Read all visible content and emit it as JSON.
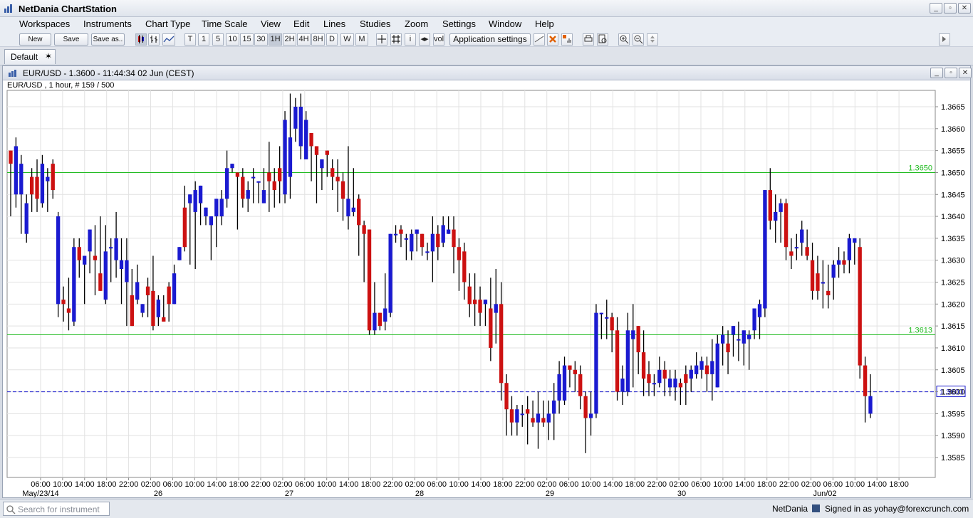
{
  "app": {
    "title": "NetDania ChartStation"
  },
  "menu": [
    "Workspaces",
    "Instruments",
    "Chart Type",
    "Time Scale",
    "View",
    "Edit",
    "Lines",
    "Studies",
    "Zoom",
    "Settings",
    "Window",
    "Help"
  ],
  "toolbar": {
    "new_label": "New",
    "save_label": "Save",
    "save_as_label": "Save as..",
    "timescales": [
      "T",
      "1",
      "5",
      "10",
      "15",
      "30",
      "1H",
      "2H",
      "4H",
      "8H",
      "D",
      "W",
      "M"
    ],
    "active_timescale": "1H",
    "app_settings_label": "Application settings"
  },
  "workspace_tab": {
    "label": "Default"
  },
  "chart_window": {
    "title": "EUR/USD - 1.3600 - 11:44:34  02 Jun (CEST)",
    "info": "EUR/USD , 1 hour, # 159 / 500"
  },
  "status": {
    "search_placeholder": "Search for instrument",
    "provider": "NetDania",
    "signed_in": "Signed in as yohay@forexcrunch.com"
  },
  "chart_data": {
    "type": "candlestick",
    "symbol": "EUR/USD",
    "interval": "1 hour",
    "ylim": [
      1.3585,
      1.3668
    ],
    "yticks": [
      "1.3665",
      "1.3660",
      "1.3655",
      "1.3650",
      "1.3645",
      "1.3640",
      "1.3635",
      "1.3630",
      "1.3625",
      "1.3620",
      "1.3615",
      "1.3610",
      "1.3605",
      "1.3600",
      "1.3595",
      "1.3590",
      "1.3585"
    ],
    "x_time_labels": [
      "06:00",
      "10:00",
      "14:00",
      "18:00",
      "22:00",
      "02:00",
      "06:00",
      "10:00",
      "14:00",
      "18:00",
      "22:00",
      "02:00",
      "06:00",
      "10:00",
      "14:00",
      "18:00",
      "22:00",
      "02:00",
      "06:00",
      "10:00",
      "14:00",
      "18:00",
      "22:00",
      "02:00",
      "06:00",
      "10:00",
      "14:00",
      "18:00",
      "22:00",
      "02:00",
      "06:00",
      "10:00",
      "14:00",
      "18:00",
      "22:00",
      "02:00",
      "06:00",
      "10:00",
      "14:00",
      "18:00"
    ],
    "x_date_labels": [
      "May/23/14",
      "26",
      "27",
      "28",
      "29",
      "30",
      "Jun/02"
    ],
    "horizontal_lines": [
      {
        "label": "1.3650",
        "value": 1.365,
        "color": "#22bb22"
      },
      {
        "label": "1.3613",
        "value": 1.3613,
        "color": "#22bb22"
      }
    ],
    "current_price": {
      "label": "1.3600",
      "value": 1.36,
      "color": "#1a1acc"
    },
    "colors": {
      "up": "#1a1ad0",
      "down": "#cc1111",
      "wick": "#000000",
      "grid": "#e2e2e2"
    },
    "candles": [
      [
        1.3655,
        1.3652,
        1.3653,
        1.364
      ],
      [
        1.3645,
        1.3656,
        1.3658,
        1.3642
      ],
      [
        1.3645,
        1.3652,
        1.3654,
        1.3636
      ],
      [
        1.3636,
        1.3643,
        1.3645,
        1.3634
      ],
      [
        1.3649,
        1.3645,
        1.3651,
        1.3641
      ],
      [
        1.3649,
        1.3644,
        1.3653,
        1.3641
      ],
      [
        1.3643,
        1.3652,
        1.3654,
        1.3642
      ],
      [
        1.3648,
        1.3649,
        1.3651,
        1.3641
      ],
      [
        1.3652,
        1.3646,
        1.3653,
        1.3644
      ],
      [
        1.362,
        1.364,
        1.3641,
        1.3617
      ],
      [
        1.3621,
        1.362,
        1.3624,
        1.3616
      ],
      [
        1.3619,
        1.3618,
        1.3626,
        1.3614
      ],
      [
        1.3616,
        1.3633,
        1.3635,
        1.3615
      ],
      [
        1.3633,
        1.363,
        1.3635,
        1.3626
      ],
      [
        1.3629,
        1.3631,
        1.3631,
        1.362
      ],
      [
        1.3632,
        1.3637,
        1.3637,
        1.3627
      ],
      [
        1.3631,
        1.363,
        1.3638,
        1.3622
      ],
      [
        1.3627,
        1.3623,
        1.364,
        1.3624
      ],
      [
        1.3621,
        1.3632,
        1.3638,
        1.362
      ],
      [
        1.3633,
        1.3633,
        1.3635,
        1.3625
      ],
      [
        1.363,
        1.3635,
        1.3641,
        1.3626
      ],
      [
        1.3628,
        1.363,
        1.3635,
        1.362
      ],
      [
        1.3625,
        1.363,
        1.3635,
        1.3615
      ],
      [
        1.3622,
        1.3615,
        1.3628,
        1.3617
      ],
      [
        1.3621,
        1.3625,
        1.3629,
        1.362
      ],
      [
        1.3618,
        1.362,
        1.362,
        1.3617
      ],
      [
        1.3624,
        1.3622,
        1.3626,
        1.3617
      ],
      [
        1.3623,
        1.3615,
        1.3631,
        1.3614
      ],
      [
        1.3617,
        1.3621,
        1.3622,
        1.3615
      ],
      [
        1.3617,
        1.3616,
        1.3622,
        1.3616
      ],
      [
        1.3624,
        1.362,
        1.3625,
        1.3616
      ],
      [
        1.362,
        1.3627,
        1.3629,
        1.362
      ],
      [
        1.363,
        1.3633,
        1.3632,
        1.3632
      ],
      [
        1.3642,
        1.3633,
        1.3647,
        1.3632
      ],
      [
        1.3643,
        1.3645,
        1.364,
        1.3629
      ],
      [
        1.3641,
        1.3646,
        1.3648,
        1.3628
      ],
      [
        1.3643,
        1.3647,
        1.3644,
        1.3638
      ],
      [
        1.364,
        1.3642,
        1.3639,
        1.3638
      ],
      [
        1.3638,
        1.364,
        1.364,
        1.363
      ],
      [
        1.364,
        1.3644,
        1.3641,
        1.3633
      ],
      [
        1.364,
        1.3644,
        1.3646,
        1.3638
      ],
      [
        1.3644,
        1.3651,
        1.3655,
        1.3642
      ],
      [
        1.3651,
        1.3652,
        1.3651,
        1.365
      ],
      [
        1.365,
        1.3649,
        1.3644,
        1.3637
      ],
      [
        1.3649,
        1.3644,
        1.3651,
        1.3642
      ],
      [
        1.3644,
        1.3646,
        1.3648,
        1.3641
      ],
      [
        1.3649,
        1.3649,
        1.3651,
        1.3643
      ],
      [
        1.3648,
        1.3648,
        1.3648,
        1.3643
      ],
      [
        1.3643,
        1.3646,
        1.3651,
        1.3644
      ],
      [
        1.365,
        1.3648,
        1.3657,
        1.3641
      ],
      [
        1.3648,
        1.3646,
        1.3651,
        1.3642
      ],
      [
        1.3651,
        1.3648,
        1.3656,
        1.3643
      ],
      [
        1.3645,
        1.3662,
        1.3664,
        1.3643
      ],
      [
        1.3649,
        1.3658,
        1.3668,
        1.3644
      ],
      [
        1.366,
        1.3665,
        1.3667,
        1.3657
      ],
      [
        1.3656,
        1.3665,
        1.3668,
        1.3653
      ],
      [
        1.3653,
        1.3662,
        1.3664,
        1.3653
      ],
      [
        1.3659,
        1.3656,
        1.3658,
        1.3648
      ],
      [
        1.3656,
        1.3654,
        1.3656,
        1.3643
      ],
      [
        1.3651,
        1.3653,
        1.3653,
        1.3646
      ],
      [
        1.3655,
        1.3654,
        1.3655,
        1.3649
      ],
      [
        1.3651,
        1.3649,
        1.3653,
        1.3646
      ],
      [
        1.3649,
        1.3648,
        1.3653,
        1.3641
      ],
      [
        1.3648,
        1.3644,
        1.365,
        1.3639
      ],
      [
        1.364,
        1.3644,
        1.3656,
        1.3637
      ],
      [
        1.3641,
        1.3642,
        1.3651,
        1.364
      ],
      [
        1.3644,
        1.3638,
        1.3645,
        1.3631
      ],
      [
        1.3638,
        1.3636,
        1.3639,
        1.3625
      ],
      [
        1.3637,
        1.3614,
        1.3636,
        1.3613
      ],
      [
        1.3614,
        1.3618,
        1.3625,
        1.3613
      ],
      [
        1.3618,
        1.3615,
        1.3617,
        1.3614
      ],
      [
        1.3616,
        1.3619,
        1.3627,
        1.3614
      ],
      [
        1.3618,
        1.3636,
        1.3636,
        1.3617
      ],
      [
        1.3636,
        1.3636,
        1.3638,
        1.3634
      ],
      [
        1.3637,
        1.3636,
        1.3638,
        1.3633
      ],
      [
        1.3635,
        1.3635,
        1.3636,
        1.363
      ],
      [
        1.3632,
        1.3636,
        1.3637,
        1.363
      ],
      [
        1.3636,
        1.3637,
        1.3637,
        1.3632
      ],
      [
        1.3636,
        1.3633,
        1.3636,
        1.3631
      ],
      [
        1.3632,
        1.3632,
        1.3634,
        1.363
      ],
      [
        1.3632,
        1.3636,
        1.364,
        1.3625
      ],
      [
        1.3636,
        1.3633,
        1.3638,
        1.363
      ],
      [
        1.3634,
        1.3638,
        1.364,
        1.3633
      ],
      [
        1.3636,
        1.3637,
        1.364,
        1.3636
      ],
      [
        1.3637,
        1.3633,
        1.364,
        1.3627
      ],
      [
        1.3633,
        1.363,
        1.3635,
        1.3623
      ],
      [
        1.3632,
        1.3625,
        1.3634,
        1.3621
      ],
      [
        1.3624,
        1.362,
        1.3627,
        1.3617
      ],
      [
        1.3621,
        1.362,
        1.3627,
        1.3615
      ],
      [
        1.3621,
        1.3618,
        1.3624,
        1.3615
      ],
      [
        1.362,
        1.3621,
        1.3621,
        1.3615
      ],
      [
        1.3619,
        1.361,
        1.3626,
        1.3607
      ],
      [
        1.3618,
        1.362,
        1.3628,
        1.3611
      ],
      [
        1.362,
        1.3602,
        1.3625,
        1.3598
      ],
      [
        1.3602,
        1.3596,
        1.3604,
        1.359
      ],
      [
        1.3596,
        1.3593,
        1.3599,
        1.359
      ],
      [
        1.3593,
        1.3596,
        1.3597,
        1.359
      ],
      [
        1.3595,
        1.3595,
        1.3597,
        1.3592
      ],
      [
        1.3596,
        1.3595,
        1.3599,
        1.3588
      ],
      [
        1.3594,
        1.3593,
        1.3598,
        1.3592
      ],
      [
        1.3593,
        1.3595,
        1.36,
        1.3587
      ],
      [
        1.3594,
        1.3593,
        1.3598,
        1.3592
      ],
      [
        1.3593,
        1.3595,
        1.3598,
        1.3589
      ],
      [
        1.3595,
        1.3598,
        1.3602,
        1.3589
      ],
      [
        1.3598,
        1.3604,
        1.3607,
        1.3595
      ],
      [
        1.3598,
        1.3606,
        1.3608,
        1.3597
      ],
      [
        1.3606,
        1.3605,
        1.3606,
        1.3601
      ],
      [
        1.3605,
        1.3604,
        1.3607,
        1.36
      ],
      [
        1.3604,
        1.3599,
        1.3606,
        1.3596
      ],
      [
        1.3599,
        1.3594,
        1.36,
        1.3586
      ],
      [
        1.3594,
        1.3595,
        1.36,
        1.359
      ],
      [
        1.3595,
        1.3618,
        1.362,
        1.3594
      ],
      [
        1.3618,
        1.3618,
        1.3618,
        1.3612
      ],
      [
        1.3617,
        1.3617,
        1.3621,
        1.3612
      ],
      [
        1.3617,
        1.3614,
        1.3618,
        1.3609
      ],
      [
        1.3614,
        1.36,
        1.3617,
        1.3598
      ],
      [
        1.36,
        1.3603,
        1.3606,
        1.3597
      ],
      [
        1.36,
        1.3614,
        1.3618,
        1.3599
      ],
      [
        1.3612,
        1.3614,
        1.362,
        1.3601
      ],
      [
        1.3615,
        1.3609,
        1.3613,
        1.3604
      ],
      [
        1.3609,
        1.3603,
        1.3614,
        1.3599
      ],
      [
        1.3604,
        1.3602,
        1.3607,
        1.3599
      ],
      [
        1.3602,
        1.3602,
        1.3604,
        1.3599
      ],
      [
        1.3602,
        1.3605,
        1.3608,
        1.3601
      ],
      [
        1.3605,
        1.3603,
        1.3607,
        1.3599
      ],
      [
        1.3601,
        1.3603,
        1.3605,
        1.3599
      ],
      [
        1.3601,
        1.3603,
        1.3605,
        1.3598
      ],
      [
        1.3602,
        1.3601,
        1.3603,
        1.3597
      ],
      [
        1.3604,
        1.3602,
        1.3606,
        1.3597
      ],
      [
        1.3603,
        1.3605,
        1.3606,
        1.36
      ],
      [
        1.3604,
        1.3606,
        1.3609,
        1.3603
      ],
      [
        1.3605,
        1.3607,
        1.3608,
        1.3603
      ],
      [
        1.3606,
        1.3604,
        1.3608,
        1.36
      ],
      [
        1.3604,
        1.3607,
        1.3612,
        1.3598
      ],
      [
        1.3601,
        1.3611,
        1.3613,
        1.3602
      ],
      [
        1.3611,
        1.3613,
        1.3615,
        1.3606
      ],
      [
        1.3611,
        1.3609,
        1.3614,
        1.3604
      ],
      [
        1.3613,
        1.3615,
        1.3615,
        1.3608
      ],
      [
        1.3612,
        1.3612,
        1.3616,
        1.3607
      ],
      [
        1.3611,
        1.3614,
        1.3614,
        1.3606
      ],
      [
        1.3612,
        1.3613,
        1.3614,
        1.3605
      ],
      [
        1.3614,
        1.3619,
        1.3618,
        1.3612
      ],
      [
        1.3617,
        1.362,
        1.3621,
        1.3612
      ],
      [
        1.3619,
        1.3646,
        1.3646,
        1.3617
      ],
      [
        1.3646,
        1.3639,
        1.3651,
        1.3637
      ],
      [
        1.3639,
        1.3641,
        1.3645,
        1.3634
      ],
      [
        1.3641,
        1.3643,
        1.3644,
        1.3634
      ],
      [
        1.3643,
        1.3633,
        1.3644,
        1.363
      ],
      [
        1.3632,
        1.3631,
        1.3635,
        1.3628
      ],
      [
        1.3633,
        1.3633,
        1.3636,
        1.363
      ],
      [
        1.3634,
        1.3637,
        1.3639,
        1.3631
      ],
      [
        1.3633,
        1.3631,
        1.3637,
        1.363
      ],
      [
        1.363,
        1.3623,
        1.3634,
        1.3621
      ],
      [
        1.3627,
        1.3623,
        1.3631,
        1.3621
      ],
      [
        1.3625,
        1.3625,
        1.363,
        1.3619
      ],
      [
        1.3623,
        1.3622,
        1.3629,
        1.3619
      ],
      [
        1.3626,
        1.3629,
        1.363,
        1.3621
      ],
      [
        1.3629,
        1.363,
        1.3633,
        1.3626
      ],
      [
        1.363,
        1.3629,
        1.3632,
        1.3627
      ],
      [
        1.363,
        1.3635,
        1.3636,
        1.3627
      ],
      [
        1.3634,
        1.3635,
        1.3635,
        1.3629
      ],
      [
        1.3633,
        1.3606,
        1.3635,
        1.3603
      ],
      [
        1.3606,
        1.3599,
        1.3608,
        1.3593
      ],
      [
        1.3595,
        1.3599,
        1.3604,
        1.3594
      ]
    ]
  }
}
